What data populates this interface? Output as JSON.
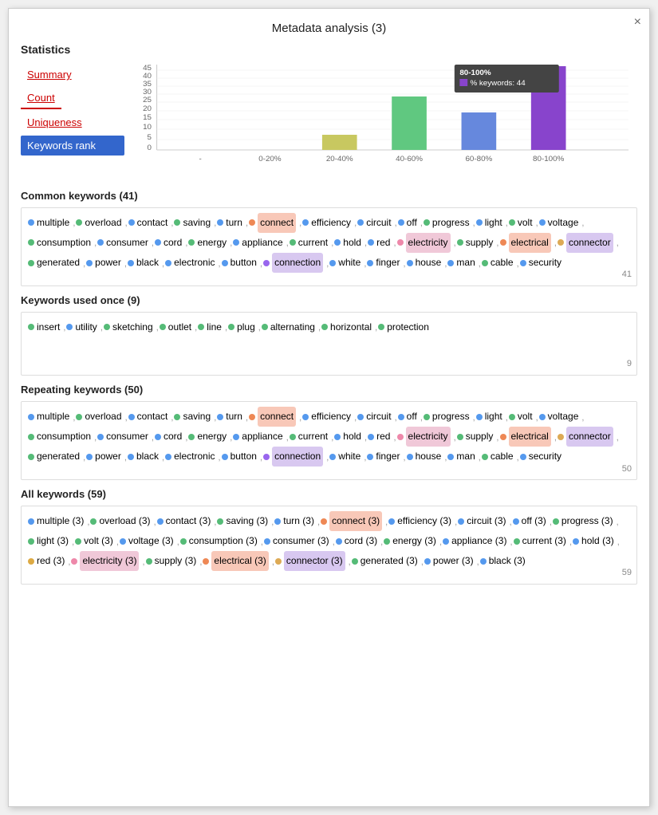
{
  "title": "Metadata analysis (3)",
  "close_label": "×",
  "statistics": {
    "label": "Statistics",
    "nav_items": [
      {
        "id": "summary",
        "label": "Summary",
        "active": false
      },
      {
        "id": "count",
        "label": "Count",
        "active": false
      },
      {
        "id": "uniqueness",
        "label": "Uniqueness",
        "active": false
      },
      {
        "id": "keywords_rank",
        "label": "Keywords rank",
        "active": true
      }
    ]
  },
  "chart": {
    "y_labels": [
      "45",
      "40",
      "35",
      "30",
      "25",
      "20",
      "15",
      "10",
      "5",
      "0"
    ],
    "x_labels": [
      "-",
      "0-20%",
      "20-40%",
      "40-60%",
      "60-80%",
      "80-100%"
    ],
    "bars": [
      {
        "label": "-",
        "value": 0,
        "color": "#aaaaaa"
      },
      {
        "label": "0-20%",
        "value": 0,
        "color": "#aaaaaa"
      },
      {
        "label": "20-40%",
        "value": 8,
        "color": "#c8c860"
      },
      {
        "label": "40-60%",
        "value": 28,
        "color": "#60c880"
      },
      {
        "label": "60-80%",
        "value": 20,
        "color": "#6688dd"
      },
      {
        "label": "80-100%",
        "value": 44,
        "color": "#8844cc"
      }
    ],
    "tooltip": {
      "title": "80-100%",
      "color": "#8844cc",
      "label": "% keywords:",
      "value": "44"
    }
  },
  "common_keywords": {
    "title": "Common keywords (41)",
    "count": "41",
    "keywords": [
      {
        "text": "multiple",
        "color": "#5599ee"
      },
      {
        "text": "overload",
        "color": "#55bb77"
      },
      {
        "text": "contact",
        "color": "#5599ee"
      },
      {
        "text": "saving",
        "color": "#55bb77"
      },
      {
        "text": "turn",
        "color": "#5599ee"
      },
      {
        "text": "connect",
        "color": "#ee8855",
        "bg": "salmon"
      },
      {
        "text": "efficiency",
        "color": "#5599ee"
      },
      {
        "text": "circuit",
        "color": "#5599ee"
      },
      {
        "text": "off",
        "color": "#5599ee"
      },
      {
        "text": "progress",
        "color": "#55bb77"
      },
      {
        "text": "light",
        "color": "#5599ee"
      },
      {
        "text": "volt",
        "color": "#55bb77"
      },
      {
        "text": "voltage",
        "color": "#5599ee"
      },
      {
        "text": "consumption",
        "color": "#55bb77"
      },
      {
        "text": "consumer",
        "color": "#5599ee"
      },
      {
        "text": "cord",
        "color": "#5599ee"
      },
      {
        "text": "energy",
        "color": "#55bb77"
      },
      {
        "text": "appliance",
        "color": "#5599ee"
      },
      {
        "text": "current",
        "color": "#55bb77"
      },
      {
        "text": "hold",
        "color": "#5599ee"
      },
      {
        "text": "red",
        "color": "#5599ee"
      },
      {
        "text": "electricity",
        "color": "#ee88aa",
        "bg": "pink"
      },
      {
        "text": "supply",
        "color": "#55bb77"
      },
      {
        "text": "electrical",
        "color": "#ee8855",
        "bg": "salmon"
      },
      {
        "text": "connector",
        "color": "#ddaa55",
        "bg": "lavender"
      },
      {
        "text": "generated",
        "color": "#55bb77"
      },
      {
        "text": "power",
        "color": "#5599ee"
      },
      {
        "text": "black",
        "color": "#5599ee"
      },
      {
        "text": "electronic",
        "color": "#5599ee"
      },
      {
        "text": "button",
        "color": "#5599ee"
      },
      {
        "text": "connection",
        "color": "#9966ee",
        "bg": "lavender"
      },
      {
        "text": "white",
        "color": "#5599ee"
      },
      {
        "text": "finger",
        "color": "#5599ee"
      },
      {
        "text": "house",
        "color": "#5599ee"
      },
      {
        "text": "man",
        "color": "#5599ee"
      },
      {
        "text": "cable",
        "color": "#55bb77"
      },
      {
        "text": "security",
        "color": "#5599ee"
      }
    ]
  },
  "keywords_once": {
    "title": "Keywords used once (9)",
    "count": "9",
    "keywords": [
      {
        "text": "insert",
        "color": "#55bb77"
      },
      {
        "text": "utility",
        "color": "#5599ee"
      },
      {
        "text": "sketching",
        "color": "#55bb77"
      },
      {
        "text": "outlet",
        "color": "#55bb77"
      },
      {
        "text": "line",
        "color": "#55bb77"
      },
      {
        "text": "plug",
        "color": "#55bb77"
      },
      {
        "text": "alternating",
        "color": "#55bb77"
      },
      {
        "text": "horizontal",
        "color": "#55bb77"
      },
      {
        "text": "protection",
        "color": "#55bb77"
      }
    ]
  },
  "repeating_keywords": {
    "title": "Repeating keywords (50)",
    "count": "50",
    "keywords": [
      {
        "text": "multiple",
        "color": "#5599ee"
      },
      {
        "text": "overload",
        "color": "#55bb77"
      },
      {
        "text": "contact",
        "color": "#5599ee"
      },
      {
        "text": "saving",
        "color": "#55bb77"
      },
      {
        "text": "turn",
        "color": "#5599ee"
      },
      {
        "text": "connect",
        "color": "#ee8855",
        "bg": "salmon"
      },
      {
        "text": "efficiency",
        "color": "#5599ee"
      },
      {
        "text": "circuit",
        "color": "#5599ee"
      },
      {
        "text": "off",
        "color": "#5599ee"
      },
      {
        "text": "progress",
        "color": "#55bb77"
      },
      {
        "text": "light",
        "color": "#5599ee"
      },
      {
        "text": "volt",
        "color": "#55bb77"
      },
      {
        "text": "voltage",
        "color": "#5599ee"
      },
      {
        "text": "consumption",
        "color": "#55bb77"
      },
      {
        "text": "consumer",
        "color": "#5599ee"
      },
      {
        "text": "cord",
        "color": "#5599ee"
      },
      {
        "text": "energy",
        "color": "#55bb77"
      },
      {
        "text": "appliance",
        "color": "#5599ee"
      },
      {
        "text": "current",
        "color": "#55bb77"
      },
      {
        "text": "hold",
        "color": "#5599ee"
      },
      {
        "text": "red",
        "color": "#5599ee"
      },
      {
        "text": "electricity",
        "color": "#ee88aa",
        "bg": "pink"
      },
      {
        "text": "supply",
        "color": "#55bb77"
      },
      {
        "text": "electrical",
        "color": "#ee8855",
        "bg": "salmon"
      },
      {
        "text": "connector",
        "color": "#ddaa55",
        "bg": "lavender"
      },
      {
        "text": "generated",
        "color": "#55bb77"
      },
      {
        "text": "power",
        "color": "#5599ee"
      },
      {
        "text": "black",
        "color": "#5599ee"
      },
      {
        "text": "electronic",
        "color": "#5599ee"
      },
      {
        "text": "button",
        "color": "#5599ee"
      },
      {
        "text": "connection",
        "color": "#9966ee",
        "bg": "lavender"
      },
      {
        "text": "white",
        "color": "#5599ee"
      },
      {
        "text": "finger",
        "color": "#5599ee"
      },
      {
        "text": "house",
        "color": "#5599ee"
      },
      {
        "text": "man",
        "color": "#5599ee"
      },
      {
        "text": "cable",
        "color": "#55bb77"
      },
      {
        "text": "security",
        "color": "#5599ee"
      }
    ]
  },
  "all_keywords": {
    "title": "All keywords (59)",
    "count": "59",
    "keywords": [
      {
        "text": "multiple (3)",
        "color": "#5599ee"
      },
      {
        "text": "overload (3)",
        "color": "#55bb77"
      },
      {
        "text": "contact (3)",
        "color": "#5599ee"
      },
      {
        "text": "saving (3)",
        "color": "#55bb77"
      },
      {
        "text": "turn (3)",
        "color": "#5599ee"
      },
      {
        "text": "connect (3)",
        "color": "#ee8855",
        "bg": "salmon"
      },
      {
        "text": "efficiency (3)",
        "color": "#5599ee"
      },
      {
        "text": "circuit (3)",
        "color": "#5599ee"
      },
      {
        "text": "off (3)",
        "color": "#5599ee"
      },
      {
        "text": "progress (3)",
        "color": "#55bb77"
      },
      {
        "text": "light (3)",
        "color": "#55bb77"
      },
      {
        "text": "volt (3)",
        "color": "#55bb77"
      },
      {
        "text": "voltage (3)",
        "color": "#5599ee"
      },
      {
        "text": "consumption (3)",
        "color": "#55bb77"
      },
      {
        "text": "consumer (3)",
        "color": "#5599ee"
      },
      {
        "text": "cord (3)",
        "color": "#5599ee"
      },
      {
        "text": "energy (3)",
        "color": "#55bb77"
      },
      {
        "text": "appliance (3)",
        "color": "#5599ee"
      },
      {
        "text": "current (3)",
        "color": "#55bb77"
      },
      {
        "text": "hold (3)",
        "color": "#5599ee"
      },
      {
        "text": "red (3)",
        "color": "#ddaa44"
      },
      {
        "text": "electricity (3)",
        "color": "#ee88aa",
        "bg": "pink"
      },
      {
        "text": "supply (3)",
        "color": "#55bb77"
      },
      {
        "text": "electrical (3)",
        "color": "#ee8855",
        "bg": "salmon"
      },
      {
        "text": "connector (3)",
        "color": "#ddaa55",
        "bg": "lavender"
      },
      {
        "text": "generated (3)",
        "color": "#55bb77"
      },
      {
        "text": "power (3)",
        "color": "#5599ee"
      },
      {
        "text": "black (3)",
        "color": "#5599ee"
      }
    ]
  }
}
